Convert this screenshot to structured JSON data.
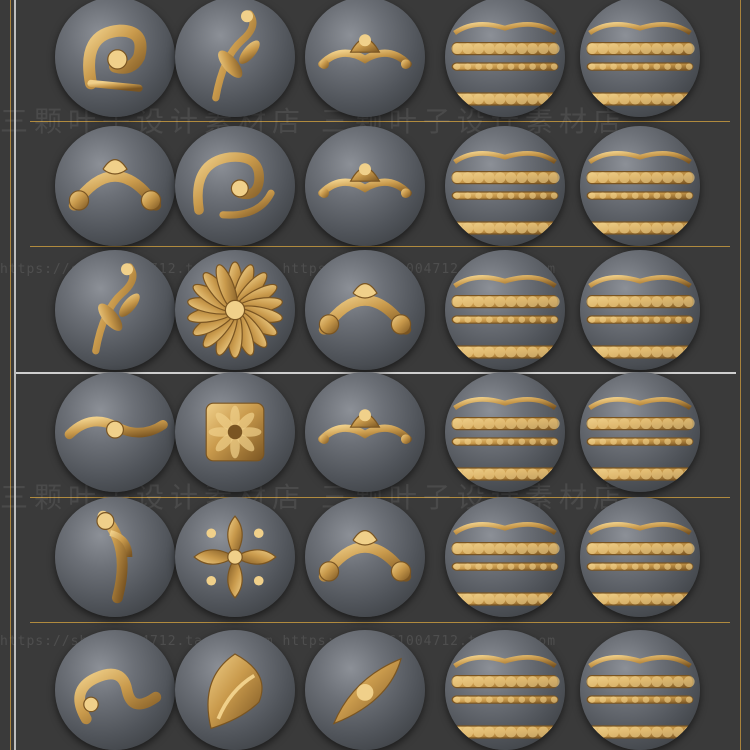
{
  "colors": {
    "background": "#3a3a3a",
    "gold": "#c99a4c",
    "gold_dark": "#7a5522",
    "gold_light": "#f0d08a",
    "sphere": "#6c7077",
    "divider": "#b08a3e"
  },
  "watermarks": {
    "text_line_1": "三颗叶子设计素材店 三颗叶子设计素材店",
    "url_line_1": "https://shop61004712.taobao.com  https://shop61004712.taobao.com",
    "text_line_2": "三颗叶子设计素材店 三颗叶子设计素材店",
    "url_line_2": "https://shop61004712.taobao.com  https://shop61004712.taobao.com"
  },
  "panels": [
    {
      "name": "top-panel",
      "rows": [
        [
          "scroll-corner",
          "leaf-scroll",
          "crest-ornament",
          "band-ornament",
          "band-ornament"
        ],
        [
          "arch-scroll",
          "double-scroll",
          "garland-ornament",
          "band-ornament",
          "band-ornament"
        ],
        [
          "vine-scroll",
          "rosette-ornament",
          "crest-arch",
          "band-ornament",
          "band-ornament"
        ]
      ]
    },
    {
      "name": "bottom-panel",
      "rows": [
        [
          "side-scroll",
          "square-rosette",
          "crown-ornament",
          "band-ornament",
          "band-ornament"
        ],
        [
          "corner-drop",
          "cross-ornament",
          "arch-garland",
          "band-ornament",
          "band-ornament"
        ],
        [
          "s-scroll",
          "acanthus-leaf",
          "corner-fan",
          "band-ornament",
          "band-ornament"
        ]
      ]
    }
  ]
}
